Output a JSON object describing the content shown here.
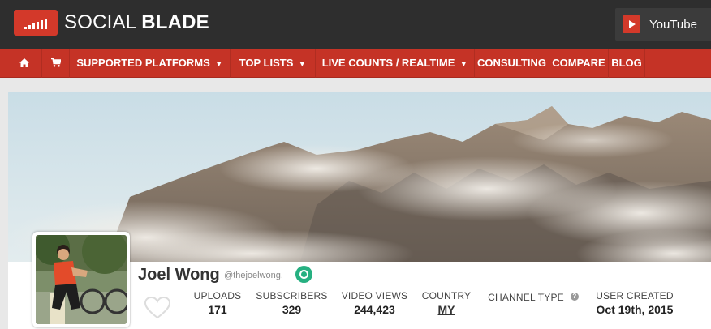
{
  "header": {
    "logo_text_regular": "SOCIAL ",
    "logo_text_bold": "BLADE",
    "logo_icon": "bar-chart-icon",
    "platform_button": {
      "label": "YouTube",
      "icon": "youtube-play-icon"
    }
  },
  "nav": {
    "home_icon": "home-icon",
    "shop_icon": "cart-icon",
    "items": [
      {
        "label": "SUPPORTED PLATFORMS",
        "dropdown": true
      },
      {
        "label": "TOP LISTS",
        "dropdown": true
      },
      {
        "label": "LIVE COUNTS / REALTIME",
        "dropdown": true
      },
      {
        "label": "CONSULTING",
        "dropdown": false
      },
      {
        "label": "COMPARE",
        "dropdown": false
      },
      {
        "label": "BLOG",
        "dropdown": false
      }
    ],
    "caret": "▼"
  },
  "channel": {
    "name": "Joel Wong",
    "handle": "@thejoelwong.",
    "verified_icon": "clock-badge-icon",
    "favorite_icon": "heart-icon",
    "stats": {
      "uploads": {
        "label": "UPLOADS",
        "value": "171"
      },
      "subscribers": {
        "label": "SUBSCRIBERS",
        "value": "329"
      },
      "video_views": {
        "label": "VIDEO VIEWS",
        "value": "244,423"
      },
      "country": {
        "label": "COUNTRY",
        "value": "MY"
      },
      "channel_type": {
        "label": "CHANNEL TYPE",
        "help": "?"
      },
      "user_created": {
        "label": "USER CREATED",
        "value": "Oct 19th, 2015"
      }
    }
  },
  "colors": {
    "header_bg": "#2e2e2e",
    "nav_bg": "#c53326",
    "accent_red": "#d3392a",
    "verified_green": "#26b081"
  }
}
